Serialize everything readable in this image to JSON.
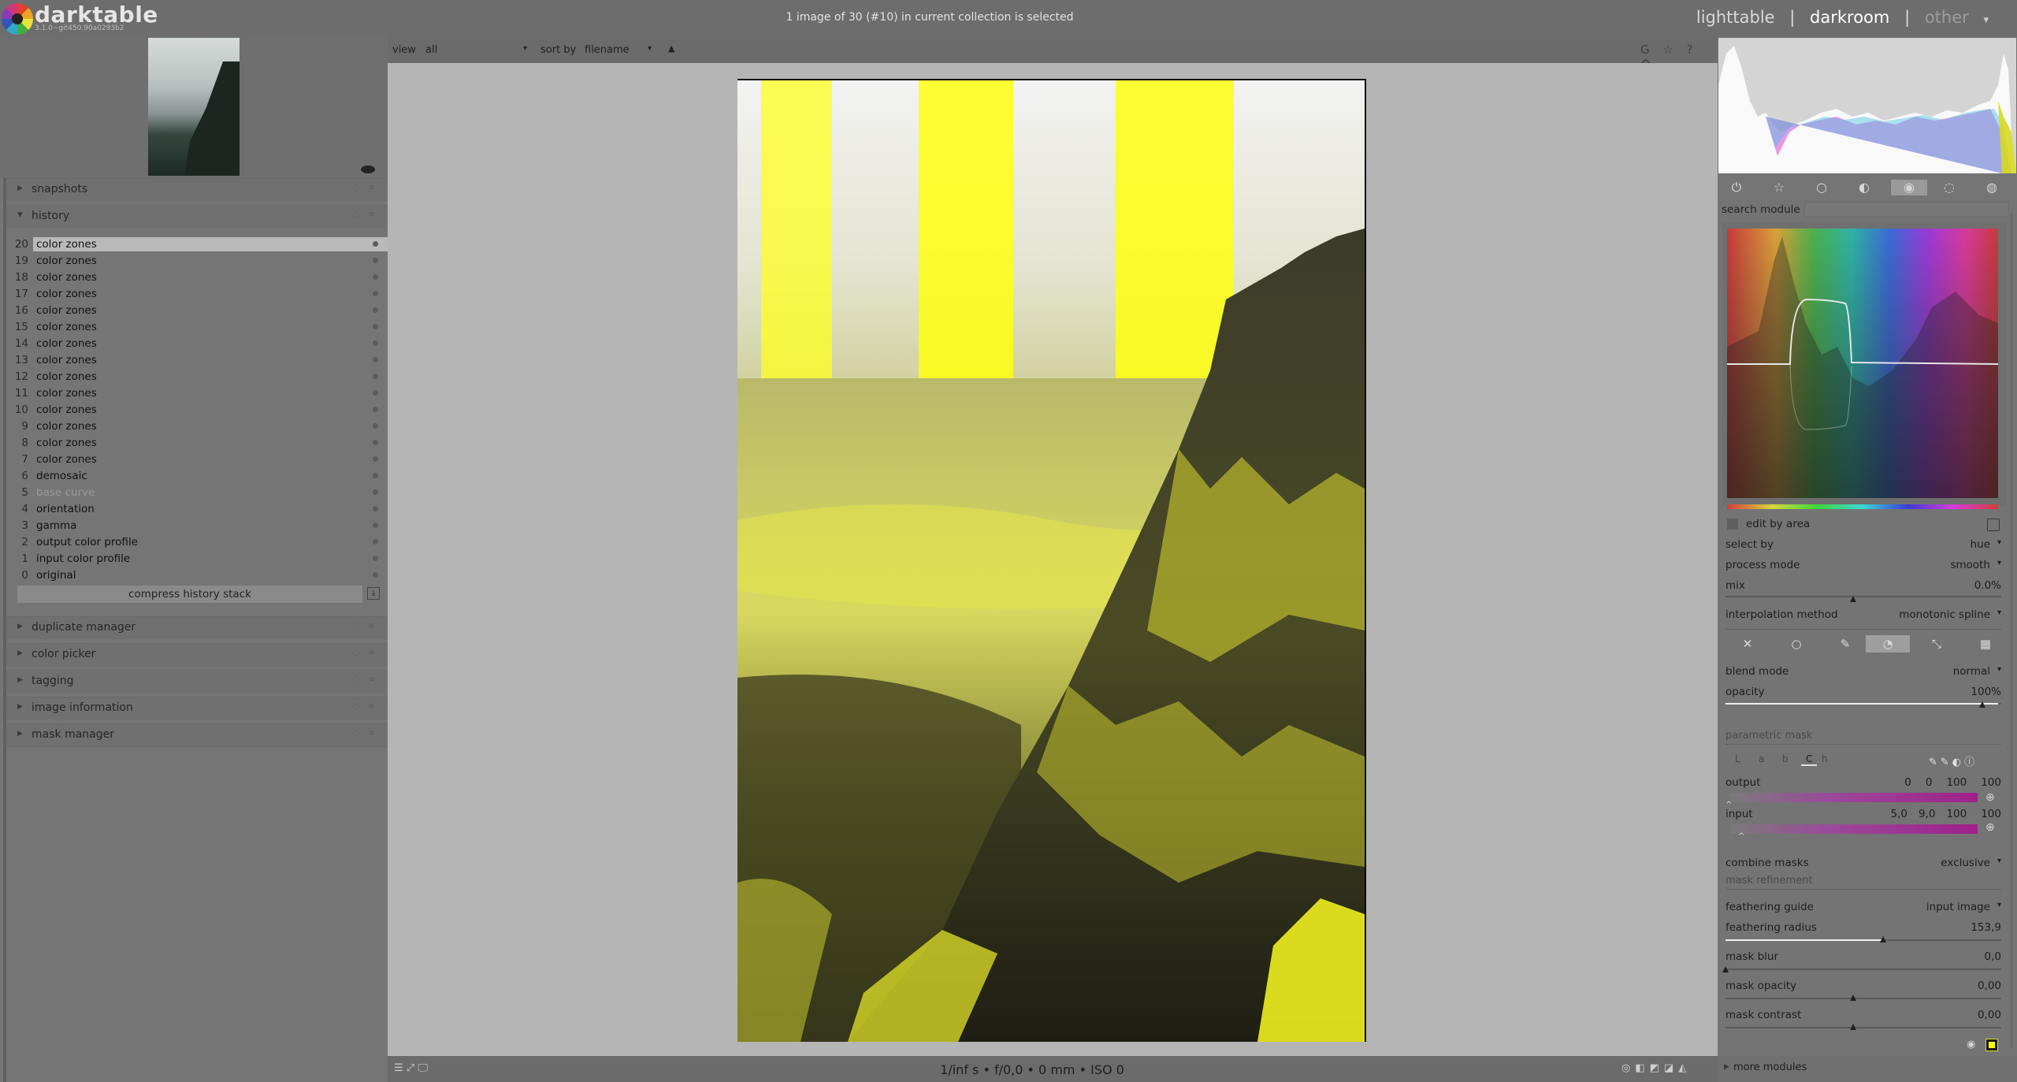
{
  "app": {
    "name": "darktable",
    "version": "3.1.0~git450.90a0293b2"
  },
  "status": {
    "selection": "1 image of 30 (#10) in current collection is selected"
  },
  "views": {
    "lighttable": "lighttable",
    "sep1": "|",
    "darkroom": "darkroom",
    "sep2": "|",
    "other": "other",
    "active": "darkroom"
  },
  "left_panel": {
    "snapshots": "snapshots",
    "history": "history",
    "history_items": [
      {
        "num": "20",
        "name": "color zones",
        "selected": true
      },
      {
        "num": "19",
        "name": "color zones"
      },
      {
        "num": "18",
        "name": "color zones"
      },
      {
        "num": "17",
        "name": "color zones"
      },
      {
        "num": "16",
        "name": "color zones"
      },
      {
        "num": "15",
        "name": "color zones"
      },
      {
        "num": "14",
        "name": "color zones"
      },
      {
        "num": "13",
        "name": "color zones"
      },
      {
        "num": "12",
        "name": "color zones"
      },
      {
        "num": "11",
        "name": "color zones"
      },
      {
        "num": "10",
        "name": "color zones"
      },
      {
        "num": "9",
        "name": "color zones"
      },
      {
        "num": "8",
        "name": "color zones"
      },
      {
        "num": "7",
        "name": "color zones"
      },
      {
        "num": "6",
        "name": "demosaic"
      },
      {
        "num": "5",
        "name": "base curve",
        "disabled": true
      },
      {
        "num": "4",
        "name": "orientation"
      },
      {
        "num": "3",
        "name": "gamma"
      },
      {
        "num": "2",
        "name": "output color profile"
      },
      {
        "num": "1",
        "name": "input color profile"
      },
      {
        "num": "0",
        "name": "original"
      }
    ],
    "compress_label": "compress history stack",
    "modules": [
      "duplicate manager",
      "color picker",
      "tagging",
      "image information",
      "mask manager"
    ]
  },
  "center_toolbar": {
    "view_label": "view",
    "view_value": "all",
    "sort_label": "sort by",
    "sort_value": "filename",
    "sort_dir": "▲",
    "right_icons": "G ☆ ? ⚙"
  },
  "exif": "1/inf s • f/0,0 • 0 mm • ISO 0",
  "right_panel": {
    "search_label": "search module",
    "edit_by_area": "edit by area",
    "select_by": {
      "label": "select by",
      "value": "hue"
    },
    "process_mode": {
      "label": "process mode",
      "value": "smooth"
    },
    "mix": {
      "label": "mix",
      "value": "0.0%"
    },
    "interpolation": {
      "label": "interpolation method",
      "value": "monotonic spline"
    },
    "blend_mode": {
      "label": "blend mode",
      "value": "normal"
    },
    "opacity": {
      "label": "opacity",
      "value": "100%",
      "level": 1.0
    },
    "parametric_mask": "parametric mask",
    "channels": [
      "L",
      "a",
      "b",
      "C",
      "h"
    ],
    "active_channel": "C",
    "output": {
      "label": "output",
      "values": [
        "0",
        "0",
        "100",
        "100"
      ]
    },
    "input": {
      "label": "input",
      "values": [
        "5,0",
        "9,0",
        "100",
        "100"
      ]
    },
    "combine_masks": {
      "label": "combine masks",
      "value": "exclusive"
    },
    "mask_refinement": "mask refinement",
    "feathering_guide": {
      "label": "feathering guide",
      "value": "input image"
    },
    "feathering_radius": {
      "label": "feathering radius",
      "value": "153,9"
    },
    "mask_blur": {
      "label": "mask blur",
      "value": "0,0"
    },
    "mask_opacity": {
      "label": "mask opacity",
      "value": "0,00"
    },
    "mask_contrast": {
      "label": "mask contrast",
      "value": "0,00"
    },
    "more_modules": "more modules"
  },
  "colors": {
    "accent_yellow": "#ffff00",
    "panel_bg": "#757575",
    "center_bg": "#b5b5b5"
  }
}
